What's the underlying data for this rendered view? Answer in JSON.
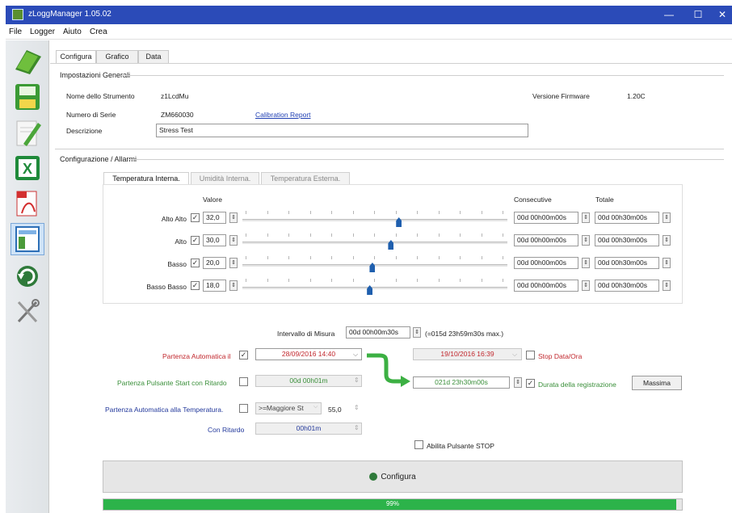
{
  "window": {
    "title": "zLoggManager 1.05.02"
  },
  "menu": [
    "File",
    "Logger",
    "Aiuto",
    "Crea"
  ],
  "toolbar": [
    "open-icon",
    "save-icon",
    "edit-notes-icon",
    "excel-export-icon",
    "pdf-export-icon",
    "layout-icon",
    "refresh-icon",
    "tools-icon"
  ],
  "tabs": [
    "Configura",
    "Grafico",
    "Data"
  ],
  "general": {
    "section": "Impostazioni Generali",
    "name_label": "Nome dello Strumento",
    "name_value": "z1LcdMu",
    "serial_label": "Numero di Serie",
    "serial_value": "ZM660030",
    "calibration_link": "Calibration Report",
    "desc_label": "Descrizione",
    "desc_value": "Stress Test",
    "firmware_label": "Versione Firmware",
    "firmware_value": "1.20C"
  },
  "alarms": {
    "section": "Configurazione / Allarmi",
    "tabs": [
      "Temperatura Interna.",
      "Umidità Interna.",
      "Temperatura Esterna."
    ],
    "col_value": "Valore",
    "col_consecutive": "Consecutive",
    "col_total": "Totale",
    "rows": [
      {
        "label": "Alto Alto",
        "value": "32,0",
        "consecutive": "00d 00h00m00s",
        "total": "00d 00h30m00s",
        "level": 0.58
      },
      {
        "label": "Alto",
        "value": "30,0",
        "consecutive": "00d 00h00m00s",
        "total": "00d 00h30m00s",
        "level": 0.55
      },
      {
        "label": "Basso",
        "value": "20,0",
        "consecutive": "00d 00h00m00s",
        "total": "00d 00h30m00s",
        "level": 0.48
      },
      {
        "label": "Basso Basso",
        "value": "18,0",
        "consecutive": "00d 00h00m00s",
        "total": "00d 00h30m00s",
        "level": 0.47
      }
    ]
  },
  "interval": {
    "label": "Intervallo di Misura",
    "value": "00d 00h00m30s",
    "max": "(=015d 23h59m30s max.)"
  },
  "start_auto": {
    "label": "Partenza Automatica il",
    "date": "28/09/2016 14:40"
  },
  "stop": {
    "date": "19/10/2016 16:39",
    "label": "Stop Data/Ora"
  },
  "start_button": {
    "label": "Partenza Pulsante Start con Ritardo",
    "value": "00d 00h01m"
  },
  "duration": {
    "value": "021d 23h30m00s",
    "label": "Durata della registrazione",
    "button": "Massima"
  },
  "start_temp": {
    "label": "Partenza Automatica alla Temperatura.",
    "condition": ">=Maggiore St",
    "value": "55,0"
  },
  "delay": {
    "label": "Con Ritardo",
    "value": "00h01m"
  },
  "stop_button": {
    "label": "Abilita Pulsante STOP"
  },
  "configure_button": {
    "label": "Configura"
  },
  "progress": {
    "label": "99%",
    "fraction": 0.99
  },
  "colors": {
    "titlebar": "#2b4bb8",
    "progress": "#2cb34a",
    "red": "#c1272d",
    "green": "#3a8f3a",
    "blue": "#243a9c"
  }
}
